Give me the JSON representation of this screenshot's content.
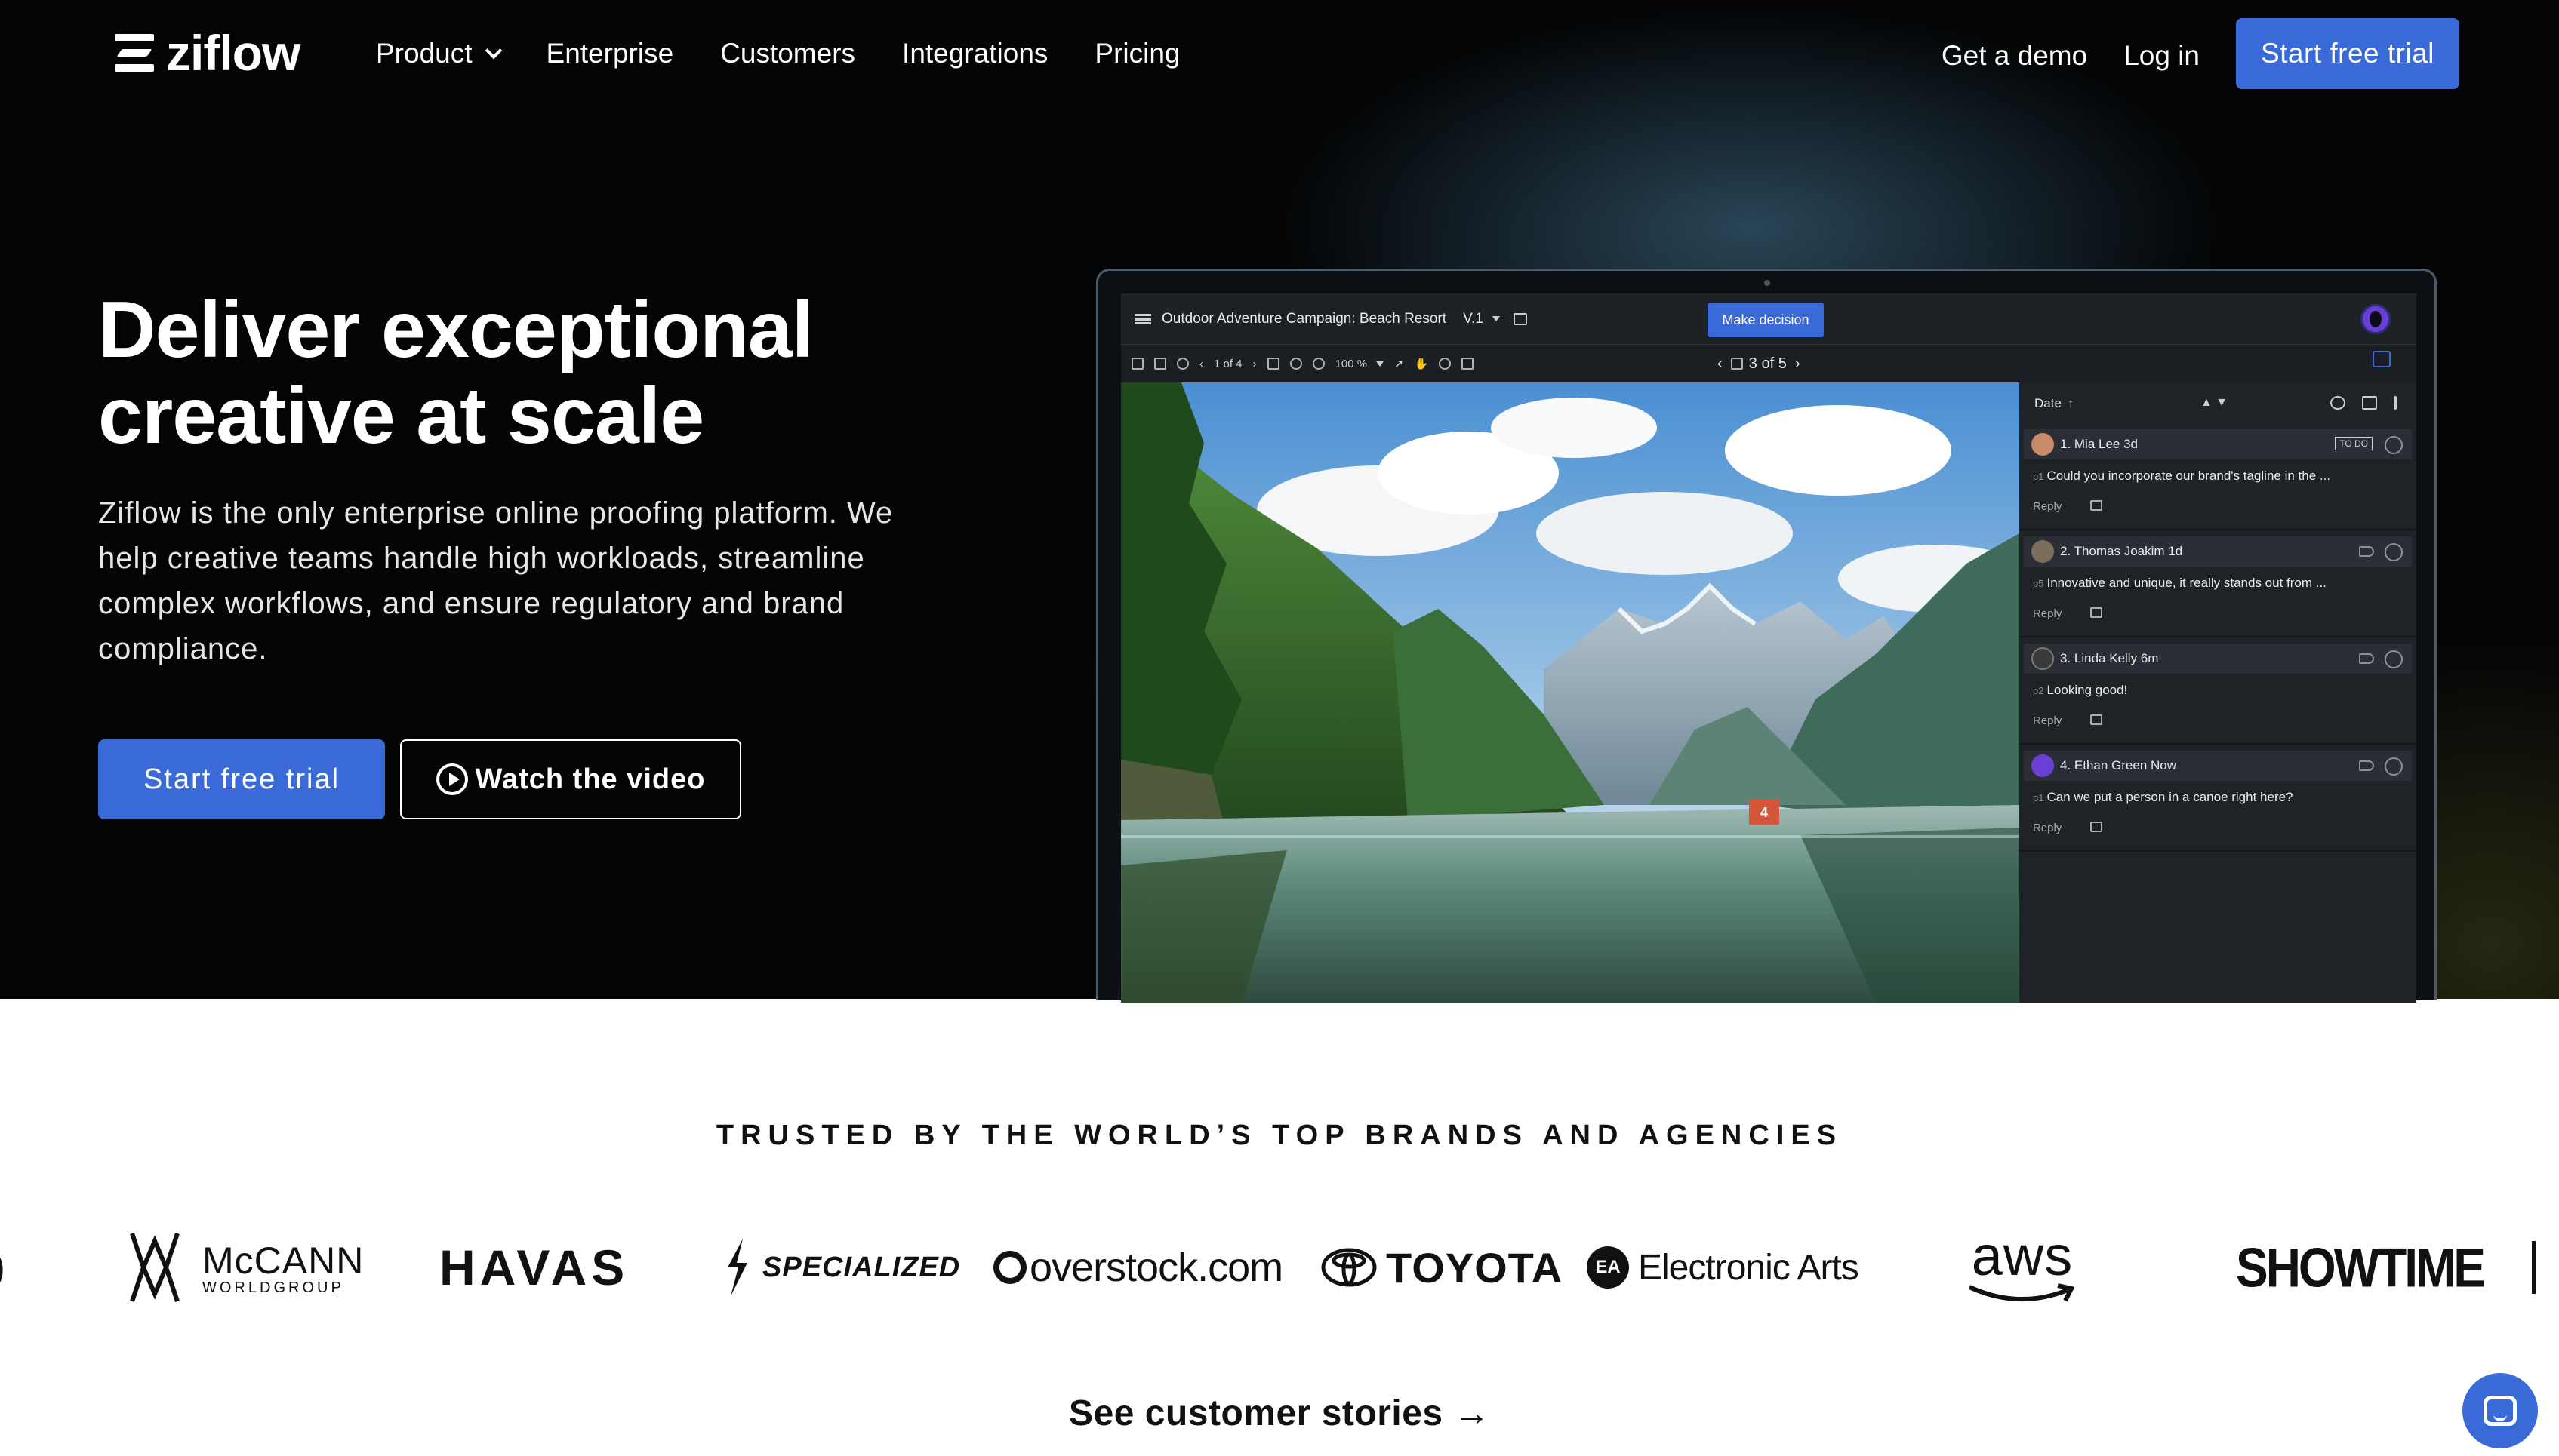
{
  "nav": {
    "logo": "ziflow",
    "items": [
      {
        "label": "Product",
        "has_dropdown": true
      },
      {
        "label": "Enterprise"
      },
      {
        "label": "Customers"
      },
      {
        "label": "Integrations"
      },
      {
        "label": "Pricing"
      }
    ],
    "get_demo": "Get a demo",
    "login": "Log in",
    "start_trial": "Start free trial"
  },
  "hero": {
    "headline": "Deliver exceptional creative at scale",
    "subtext": "Ziflow is the only enterprise online proofing platform. We help creative teams handle high workloads, streamline complex workflows, and ensure regulatory and brand compliance.",
    "cta_primary": "Start free trial",
    "cta_secondary": "Watch the video"
  },
  "app_mock": {
    "title": "Outdoor Adventure Campaign: Beach Resort",
    "version": "V.1",
    "decision_button": "Make decision",
    "page_indicator": "1 of 4",
    "zoom": "100 %",
    "asset_pager": "3 of 5",
    "comment_count_badge": "4",
    "marker_number": "4",
    "sidebar_sort": "Date",
    "comments": [
      {
        "header": "1. Mia Lee 3d",
        "status": "TO DO",
        "page": "p1",
        "text": "Could you incorporate our brand's tagline in the ...",
        "reply": "Reply",
        "avatar_color": "#c98a6a"
      },
      {
        "header": "2. Thomas Joakim 1d",
        "status": "",
        "page": "p5",
        "text": "Innovative and unique, it really stands out from ...",
        "reply": "Reply",
        "avatar_color": "#7a6d5c"
      },
      {
        "header": "3. Linda Kelly 6m",
        "status": "",
        "page": "p2",
        "text": "Looking good!",
        "reply": "Reply",
        "avatar_color": "#3a3a3a"
      },
      {
        "header": "4. Ethan Green Now",
        "status": "",
        "page": "p1",
        "text": "Can we put a person in a canoe right here?",
        "reply": "Reply",
        "avatar_color": "#6a3fd6"
      }
    ]
  },
  "brands": {
    "heading": "TRUSTED BY THE WORLD’S TOP BRANDS AND AGENCIES",
    "logos": [
      {
        "name": "McCANN",
        "sub": "WORLDGROUP"
      },
      {
        "name": "HAVAS"
      },
      {
        "name": "SPECIALIZED"
      },
      {
        "name": "overstock.com"
      },
      {
        "name": "TOYOTA"
      },
      {
        "name": "Electronic Arts",
        "badge": "EA"
      },
      {
        "name": "aws"
      },
      {
        "name": "SHOWTIME"
      }
    ],
    "see_stories": "See customer stories →"
  },
  "colors": {
    "accent": "#3a6ad8",
    "hero_bg": "#030405"
  }
}
